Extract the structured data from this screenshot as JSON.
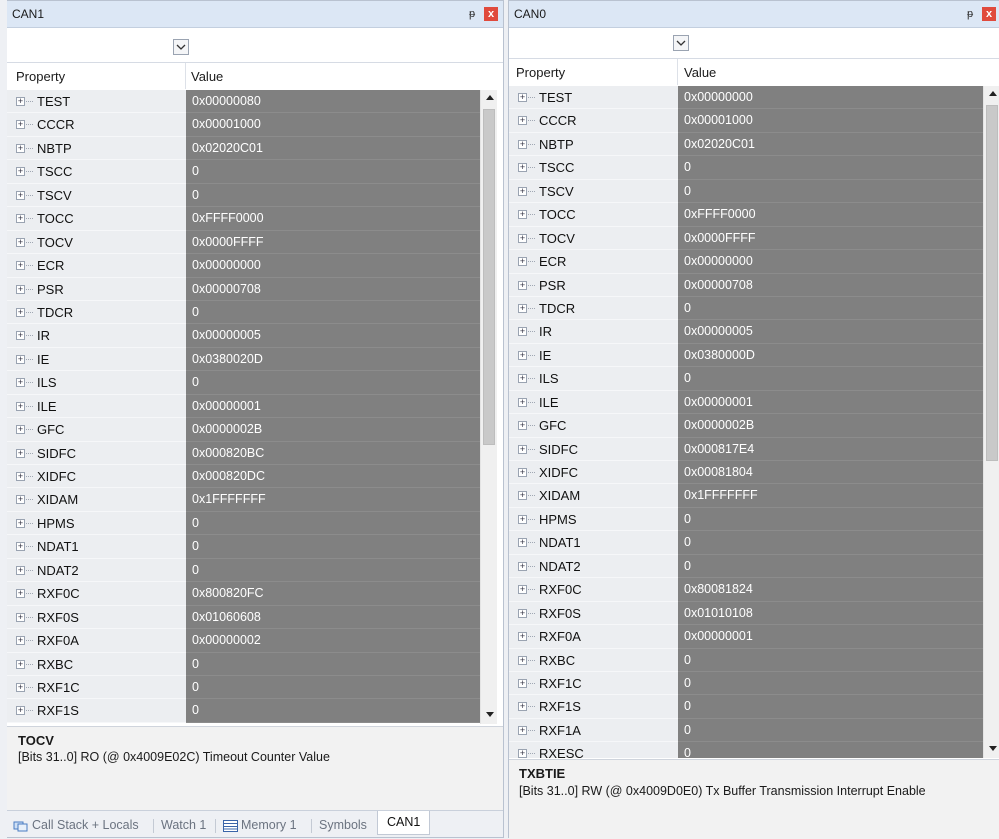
{
  "colors": {
    "titlebar_bg": "#dce7f5",
    "value_bg": "#808080",
    "value_text": "#ffffff",
    "property_bg": "#eceef1",
    "close_red": "#e04a3c"
  },
  "icons": {
    "pin": "pin-icon",
    "close": "close-icon",
    "dropdown": "chevron-down-icon",
    "expand": "plus-box-icon",
    "call_stack": "call-stack-icon",
    "memory": "memory-icon"
  },
  "can1": {
    "title": "CAN1",
    "pin_glyph": "ᵽ",
    "close_glyph": "x",
    "header": {
      "property": "Property",
      "value": "Value"
    },
    "rows": [
      {
        "name": "TEST",
        "value": "0x00000080"
      },
      {
        "name": "CCCR",
        "value": "0x00001000"
      },
      {
        "name": "NBTP",
        "value": "0x02020C01"
      },
      {
        "name": "TSCC",
        "value": "0"
      },
      {
        "name": "TSCV",
        "value": "0"
      },
      {
        "name": "TOCC",
        "value": "0xFFFF0000"
      },
      {
        "name": "TOCV",
        "value": "0x0000FFFF"
      },
      {
        "name": "ECR",
        "value": "0x00000000"
      },
      {
        "name": "PSR",
        "value": "0x00000708"
      },
      {
        "name": "TDCR",
        "value": "0"
      },
      {
        "name": "IR",
        "value": "0x00000005"
      },
      {
        "name": "IE",
        "value": "0x0380020D"
      },
      {
        "name": "ILS",
        "value": "0"
      },
      {
        "name": "ILE",
        "value": "0x00000001"
      },
      {
        "name": "GFC",
        "value": "0x0000002B"
      },
      {
        "name": "SIDFC",
        "value": "0x000820BC"
      },
      {
        "name": "XIDFC",
        "value": "0x000820DC"
      },
      {
        "name": "XIDAM",
        "value": "0x1FFFFFFF"
      },
      {
        "name": "HPMS",
        "value": "0"
      },
      {
        "name": "NDAT1",
        "value": "0"
      },
      {
        "name": "NDAT2",
        "value": "0"
      },
      {
        "name": "RXF0C",
        "value": "0x800820FC"
      },
      {
        "name": "RXF0S",
        "value": "0x01060608"
      },
      {
        "name": "RXF0A",
        "value": "0x00000002"
      },
      {
        "name": "RXBC",
        "value": "0"
      },
      {
        "name": "RXF1C",
        "value": "0"
      },
      {
        "name": "RXF1S",
        "value": "0"
      }
    ],
    "description": {
      "name": "TOCV",
      "text": "[Bits 31..0] RO (@ 0x4009E02C) Timeout Counter Value"
    },
    "tabs": [
      {
        "label": "Call Stack + Locals",
        "active": false
      },
      {
        "label": "Watch 1",
        "active": false
      },
      {
        "label": "Memory 1",
        "active": false
      },
      {
        "label": "Symbols",
        "active": false
      },
      {
        "label": "CAN1",
        "active": true
      }
    ]
  },
  "can0": {
    "title": "CAN0",
    "pin_glyph": "ᵽ",
    "close_glyph": "x",
    "header": {
      "property": "Property",
      "value": "Value"
    },
    "rows": [
      {
        "name": "TEST",
        "value": "0x00000000"
      },
      {
        "name": "CCCR",
        "value": "0x00001000"
      },
      {
        "name": "NBTP",
        "value": "0x02020C01"
      },
      {
        "name": "TSCC",
        "value": "0"
      },
      {
        "name": "TSCV",
        "value": "0"
      },
      {
        "name": "TOCC",
        "value": "0xFFFF0000"
      },
      {
        "name": "TOCV",
        "value": "0x0000FFFF"
      },
      {
        "name": "ECR",
        "value": "0x00000000"
      },
      {
        "name": "PSR",
        "value": "0x00000708"
      },
      {
        "name": "TDCR",
        "value": "0"
      },
      {
        "name": "IR",
        "value": "0x00000005"
      },
      {
        "name": "IE",
        "value": "0x0380000D"
      },
      {
        "name": "ILS",
        "value": "0"
      },
      {
        "name": "ILE",
        "value": "0x00000001"
      },
      {
        "name": "GFC",
        "value": "0x0000002B"
      },
      {
        "name": "SIDFC",
        "value": "0x000817E4"
      },
      {
        "name": "XIDFC",
        "value": "0x00081804"
      },
      {
        "name": "XIDAM",
        "value": "0x1FFFFFFF"
      },
      {
        "name": "HPMS",
        "value": "0"
      },
      {
        "name": "NDAT1",
        "value": "0"
      },
      {
        "name": "NDAT2",
        "value": "0"
      },
      {
        "name": "RXF0C",
        "value": "0x80081824"
      },
      {
        "name": "RXF0S",
        "value": "0x01010108"
      },
      {
        "name": "RXF0A",
        "value": "0x00000001"
      },
      {
        "name": "RXBC",
        "value": "0"
      },
      {
        "name": "RXF1C",
        "value": "0"
      },
      {
        "name": "RXF1S",
        "value": "0"
      },
      {
        "name": "RXF1A",
        "value": "0"
      },
      {
        "name": "RXESC",
        "value": "0"
      }
    ],
    "description": {
      "name": "TXBTIE",
      "text": "[Bits 31..0] RW (@ 0x4009D0E0) Tx Buffer Transmission Interrupt Enable"
    }
  }
}
